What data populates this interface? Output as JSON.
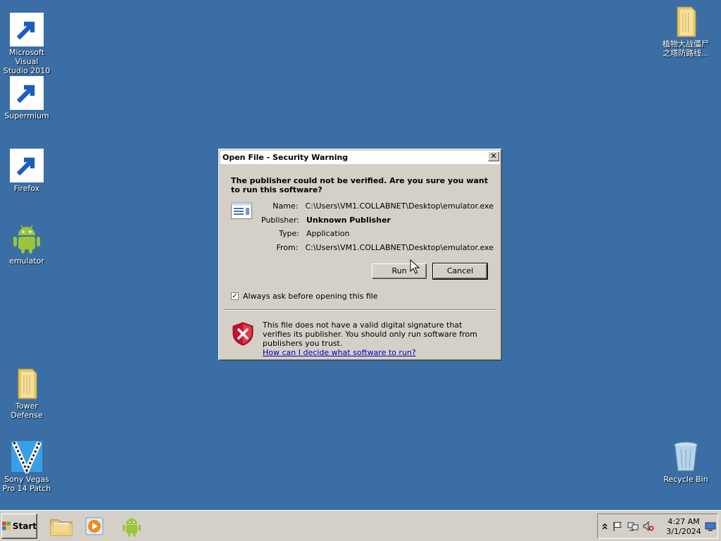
{
  "desktop": {
    "icons_left": [
      {
        "label_1": "Microsoft Visual",
        "label_2": "Studio 2010"
      },
      {
        "label_1": "Supermium"
      },
      {
        "label_1": "Firefox"
      },
      {
        "label_1": "emulator"
      },
      {
        "label_1": "Tower Defense"
      },
      {
        "label_1": "Sony Vegas",
        "label_2": "Pro 14 Patch"
      }
    ],
    "icons_right": [
      {
        "label_1": "植物大战僵尸",
        "label_2": "之塔防路线..."
      },
      {
        "label_1": "Recycle Bin"
      }
    ]
  },
  "dialog": {
    "title": "Open File - Security Warning",
    "close_glyph": "✕",
    "headline": "The publisher could not be verified.  Are you sure you want to run this software?",
    "fields": [
      {
        "key": "Name:",
        "value": "C:\\Users\\VM1.COLLABNET\\Desktop\\emulator.exe"
      },
      {
        "key": "Publisher:",
        "value": "Unknown Publisher"
      },
      {
        "key": "Type:",
        "value": "Application"
      },
      {
        "key": "From:",
        "value": "C:\\Users\\VM1.COLLABNET\\Desktop\\emulator.exe"
      }
    ],
    "run_label": "Run",
    "cancel_label": "Cancel",
    "checkbox_label": "Always ask before opening this file",
    "checkbox_checked": true,
    "checkbox_glyph": "✓",
    "warning_text": "This file does not have a valid digital signature that verifies its publisher.  You should only run software from publishers you trust.",
    "help_link": "How can I decide what software to run?"
  },
  "taskbar": {
    "start_label": "Start",
    "pinned_icons": [
      "folder-icon",
      "media-player-icon",
      "android-icon"
    ],
    "tray_icons": [
      "chevron-up-icon",
      "flag-icon",
      "network-icon",
      "speaker-muted-icon",
      "show-desktop-icon"
    ],
    "clock_time": "4:27 AM",
    "clock_date": "3/1/2024"
  },
  "colors": {
    "desktop": "#3a6ea5",
    "dialog": "#d4d0c8",
    "link": "#0000c0"
  }
}
